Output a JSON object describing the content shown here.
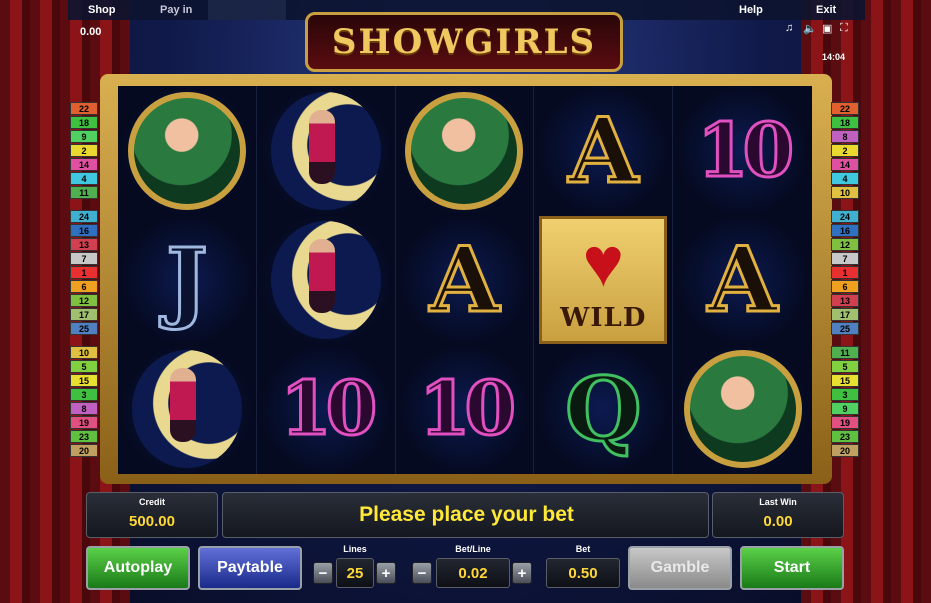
{
  "topbar": {
    "shop": "Shop",
    "payin": "Pay in",
    "help": "Help",
    "exit": "Exit",
    "credit_top": "0.00",
    "time": "14:04"
  },
  "logo": {
    "text": "SHOWGIRLS"
  },
  "reels": [
    [
      "medallion",
      "moon",
      "medallion",
      "A",
      "10"
    ],
    [
      "J",
      "moon",
      "A",
      "wild",
      "A"
    ],
    [
      "moon",
      "10",
      "10",
      "Q",
      "medallion"
    ]
  ],
  "wild_label": "WILD",
  "lines_left": [
    {
      "n": "22",
      "c": "#e06030"
    },
    {
      "n": "18",
      "c": "#40c040"
    },
    {
      "n": "9",
      "c": "#50d060"
    },
    {
      "n": "2",
      "c": "#e8d830"
    },
    {
      "n": "14",
      "c": "#e050a0"
    },
    {
      "n": "4",
      "c": "#40c8e0"
    },
    {
      "n": "11",
      "c": "#50b050"
    },
    {
      "n": "24",
      "c": "#40b0d0"
    },
    {
      "n": "16",
      "c": "#3070c0"
    },
    {
      "n": "13",
      "c": "#d04050"
    },
    {
      "n": "7",
      "c": "#c8c8c8"
    },
    {
      "n": "1",
      "c": "#e83030"
    },
    {
      "n": "6",
      "c": "#f0a020"
    },
    {
      "n": "12",
      "c": "#80c040"
    },
    {
      "n": "17",
      "c": "#a0c070"
    },
    {
      "n": "25",
      "c": "#5080c0"
    },
    {
      "n": "10",
      "c": "#e0c040"
    },
    {
      "n": "5",
      "c": "#80d040"
    },
    {
      "n": "15",
      "c": "#e8e030"
    },
    {
      "n": "3",
      "c": "#40c040"
    },
    {
      "n": "8",
      "c": "#c060c0"
    },
    {
      "n": "19",
      "c": "#e05080"
    },
    {
      "n": "23",
      "c": "#60c040"
    },
    {
      "n": "20",
      "c": "#c0a060"
    }
  ],
  "lines_right": [
    {
      "n": "22",
      "c": "#e06030"
    },
    {
      "n": "18",
      "c": "#40c040"
    },
    {
      "n": "8",
      "c": "#c060c0"
    },
    {
      "n": "2",
      "c": "#e8d830"
    },
    {
      "n": "14",
      "c": "#e050a0"
    },
    {
      "n": "4",
      "c": "#40c8e0"
    },
    {
      "n": "10",
      "c": "#e0c040"
    },
    {
      "n": "24",
      "c": "#40b0d0"
    },
    {
      "n": "16",
      "c": "#3070c0"
    },
    {
      "n": "12",
      "c": "#80c040"
    },
    {
      "n": "7",
      "c": "#c8c8c8"
    },
    {
      "n": "1",
      "c": "#e83030"
    },
    {
      "n": "6",
      "c": "#f0a020"
    },
    {
      "n": "13",
      "c": "#d04050"
    },
    {
      "n": "17",
      "c": "#a0c070"
    },
    {
      "n": "25",
      "c": "#5080c0"
    },
    {
      "n": "11",
      "c": "#50b050"
    },
    {
      "n": "5",
      "c": "#80d040"
    },
    {
      "n": "15",
      "c": "#e8e030"
    },
    {
      "n": "3",
      "c": "#40c040"
    },
    {
      "n": "9",
      "c": "#50d060"
    },
    {
      "n": "19",
      "c": "#e05080"
    },
    {
      "n": "23",
      "c": "#60c040"
    },
    {
      "n": "20",
      "c": "#c0a060"
    }
  ],
  "credit": {
    "label": "Credit",
    "value": "500.00"
  },
  "message": "Please place your bet",
  "last_win": {
    "label": "Last Win",
    "value": "0.00"
  },
  "controls": {
    "autoplay": "Autoplay",
    "paytable": "Paytable",
    "gamble": "Gamble",
    "start": "Start",
    "lines_label": "Lines",
    "lines_value": "25",
    "betline_label": "Bet/Line",
    "betline_value": "0.02",
    "bet_label": "Bet",
    "bet_value": "0.50",
    "minus": "−",
    "plus": "+"
  }
}
